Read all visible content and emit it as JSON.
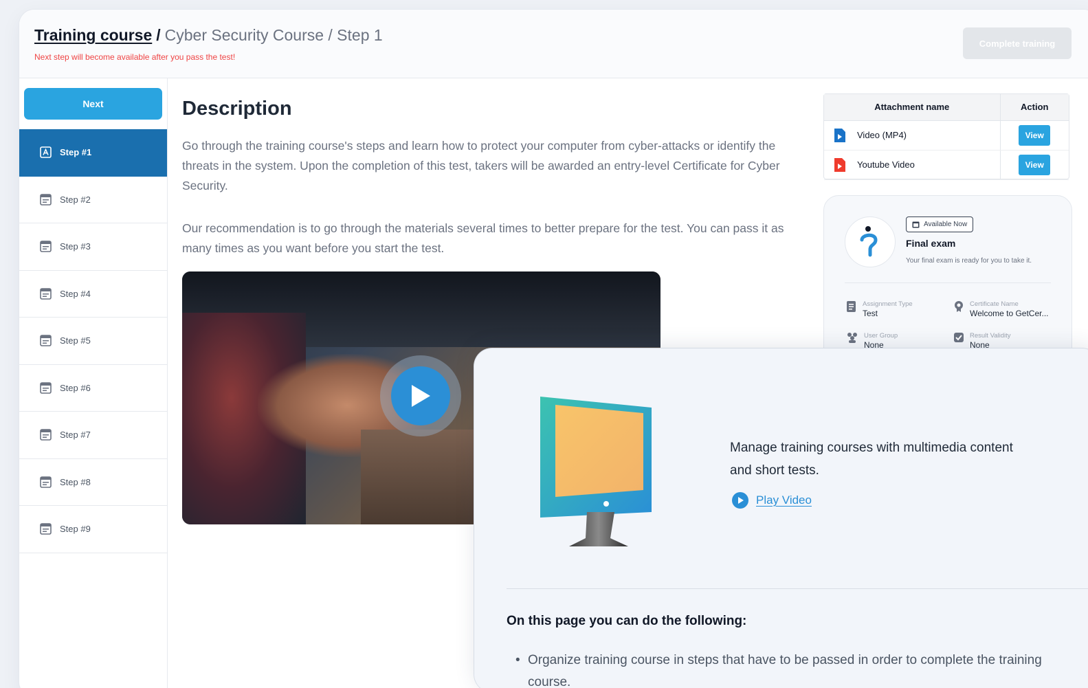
{
  "header": {
    "breadcrumb_link": "Training course",
    "breadcrumb_sep": "/",
    "breadcrumb_rest": "Cyber Security Course / Step 1",
    "notice": "Next step will become available after you pass the test!",
    "complete_label": "Complete training"
  },
  "sidebar": {
    "next_label": "Next",
    "steps": [
      {
        "label": "Step #1",
        "icon": "step-a-icon"
      },
      {
        "label": "Step #2",
        "icon": "form-icon"
      },
      {
        "label": "Step #3",
        "icon": "form-icon"
      },
      {
        "label": "Step #4",
        "icon": "form-icon"
      },
      {
        "label": "Step #5",
        "icon": "form-icon"
      },
      {
        "label": "Step #6",
        "icon": "form-icon"
      },
      {
        "label": "Step #7",
        "icon": "form-icon"
      },
      {
        "label": "Step #8",
        "icon": "form-icon"
      },
      {
        "label": "Step #9",
        "icon": "form-icon"
      }
    ],
    "active_step": 0
  },
  "main": {
    "title": "Description",
    "paragraph1": "Go through the training course's steps and learn how to protect your computer from cyber-attacks or identify the threats in the system. Upon the completion of this test, takers will be awarded an entry-level Certificate for Cyber Security.",
    "paragraph2": "Our recommendation is to go through the materials several times to better prepare for the test. You can pass it as many times as you want before you start the test."
  },
  "attachments": {
    "col_name": "Attachment name",
    "col_action": "Action",
    "rows": [
      {
        "name": "Video (MP4)",
        "icon": "file-video-icon",
        "icon_color": "#1a73c8",
        "action": "View"
      },
      {
        "name": "Youtube Video",
        "icon": "youtube-icon",
        "icon_color": "#ef3b2d",
        "action": "View"
      }
    ]
  },
  "exam": {
    "badge": "Available Now",
    "title": "Final exam",
    "subtitle": "Your final exam is ready for you to take it.",
    "assignment_type_label": "Assignment Type",
    "assignment_type_value": "Test",
    "certificate_label": "Certificate Name",
    "certificate_value": "Welcome to GetCer...",
    "user_group_label": "User Group",
    "user_group_value": "None",
    "result_validity_label": "Result Validity",
    "result_validity_value": "None"
  },
  "overlay": {
    "description": "Manage training courses with multimedia content and short tests.",
    "play_label": "Play Video",
    "heading": "On this page you can do the following:",
    "items": [
      "Organize training course in steps that have to be passed in order to complete the training course."
    ]
  },
  "colors": {
    "accent": "#2aa4e0",
    "active_step": "#1a6fae",
    "notice": "#ef4444",
    "link": "#2a8fd6"
  }
}
